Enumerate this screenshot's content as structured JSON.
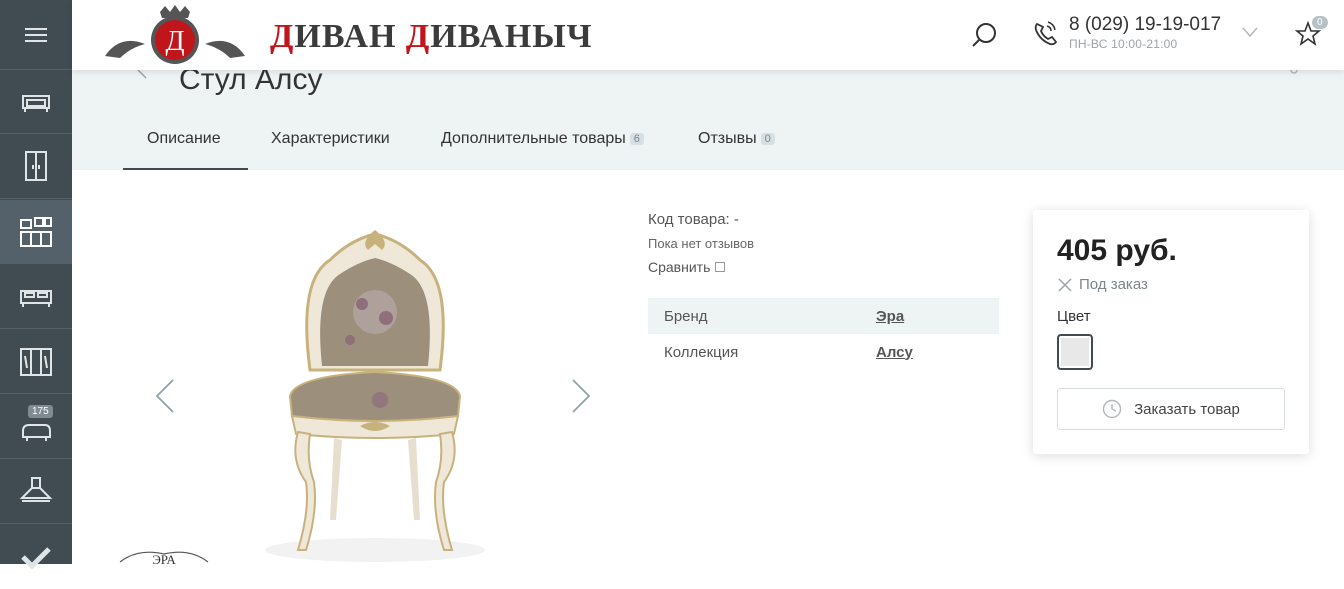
{
  "header": {
    "logo_letter": "Д",
    "logo_text_1a": "Д",
    "logo_text_1b": "ИВАН ",
    "logo_text_2a": "Д",
    "logo_text_2b": "ИВАНЫЧ",
    "phone": "8 (029) 19-19-017",
    "hours": "ПН-ВС 10:00-21:00",
    "fav_count": "0"
  },
  "sidebar": {
    "items": [
      {
        "icon": "menu-icon"
      },
      {
        "icon": "sofa-icon"
      },
      {
        "icon": "wardrobe-icon"
      },
      {
        "icon": "kitchen-icon"
      },
      {
        "icon": "bed-icon"
      },
      {
        "icon": "closet-icon"
      },
      {
        "icon": "sale-sofa-icon",
        "badge": "175"
      },
      {
        "icon": "hood-icon"
      },
      {
        "icon": "check-icon"
      }
    ]
  },
  "product": {
    "title": "Стул Алсу",
    "tabs": [
      {
        "label": "Описание"
      },
      {
        "label": "Характеристики"
      },
      {
        "label": "Дополнительные товары",
        "count": "6"
      },
      {
        "label": "Отзывы",
        "count": "0"
      }
    ],
    "code": "Код товара: -",
    "reviews": "Пока нет отзывов",
    "compare": "Сравнить",
    "props": [
      {
        "name": "Бренд",
        "value": "Эра"
      },
      {
        "name": "Коллекция",
        "value": "Алсу"
      }
    ],
    "price": "405 руб.",
    "stock": "Под заказ",
    "color_label": "Цвет",
    "order_button": "Заказать товар",
    "brand_logo_text": "ЭРА"
  },
  "colors": {
    "sidebar": "#414b52",
    "band": "#eef3f4",
    "logo_red": "#c0161b"
  }
}
